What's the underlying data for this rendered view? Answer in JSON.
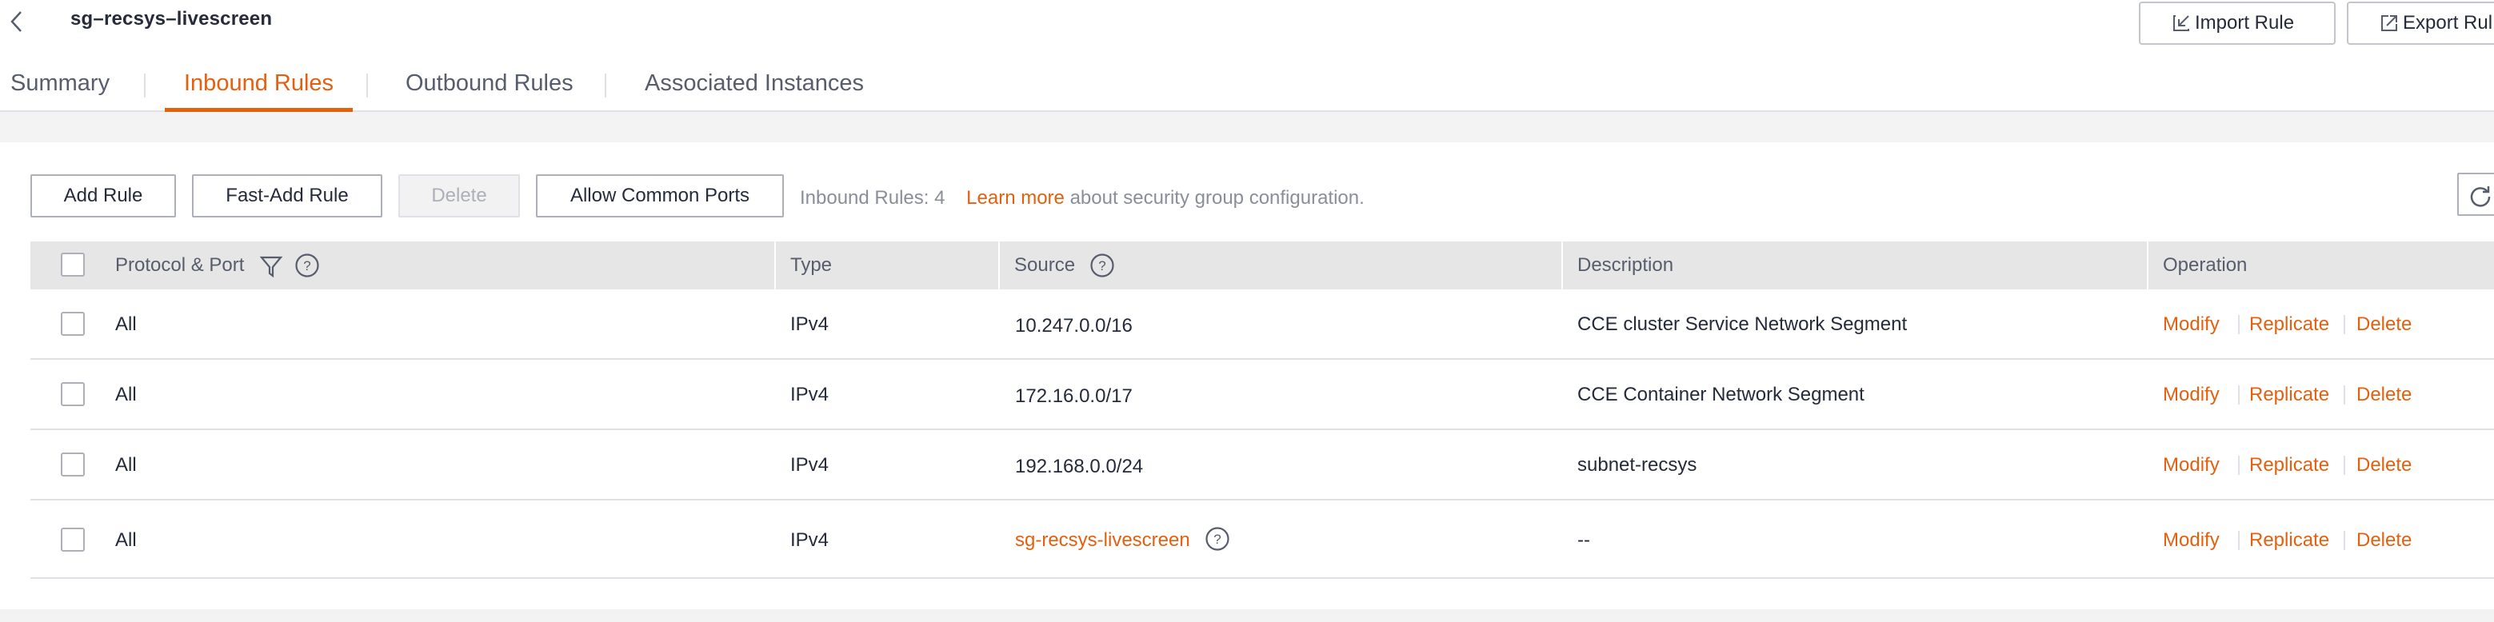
{
  "header": {
    "title": "sg–recsys–livescreen",
    "import_label": "Import Rule",
    "export_label": "Export Rul"
  },
  "tabs": [
    {
      "label": "Summary",
      "active": false
    },
    {
      "label": "Inbound Rules",
      "active": true
    },
    {
      "label": "Outbound Rules",
      "active": false
    },
    {
      "label": "Associated Instances",
      "active": false
    }
  ],
  "toolbar": {
    "add_rule": "Add Rule",
    "fast_add_rule": "Fast-Add Rule",
    "delete": "Delete",
    "allow_common_ports": "Allow Common Ports",
    "count_text": "Inbound Rules: 4",
    "learn_more": "Learn more",
    "about_text": "about security group configuration."
  },
  "table": {
    "headers": {
      "protocol_port": "Protocol & Port",
      "type": "Type",
      "source": "Source",
      "description": "Description",
      "operation": "Operation"
    },
    "rows": [
      {
        "protocol": "All",
        "type": "IPv4",
        "source": "10.247.0.0/16",
        "source_is_link": false,
        "description": "CCE cluster Service Network Segment",
        "modify": "Modify",
        "replicate": "Replicate",
        "delete": "Delete"
      },
      {
        "protocol": "All",
        "type": "IPv4",
        "source": "172.16.0.0/17",
        "source_is_link": false,
        "description": "CCE Container Network Segment",
        "modify": "Modify",
        "replicate": "Replicate",
        "delete": "Delete"
      },
      {
        "protocol": "All",
        "type": "IPv4",
        "source": "192.168.0.0/24",
        "source_is_link": false,
        "description": "subnet-recsys",
        "modify": "Modify",
        "replicate": "Replicate",
        "delete": "Delete"
      },
      {
        "protocol": "All",
        "type": "IPv4",
        "source": "sg-recsys-livescreen",
        "source_is_link": true,
        "description": "--",
        "modify": "Modify",
        "replicate": "Replicate",
        "delete": "Delete"
      }
    ]
  },
  "colors": {
    "accent": "#e4600f",
    "text": "#252b3a",
    "muted": "#8a8e99",
    "header_bg": "#e6e6e6"
  }
}
